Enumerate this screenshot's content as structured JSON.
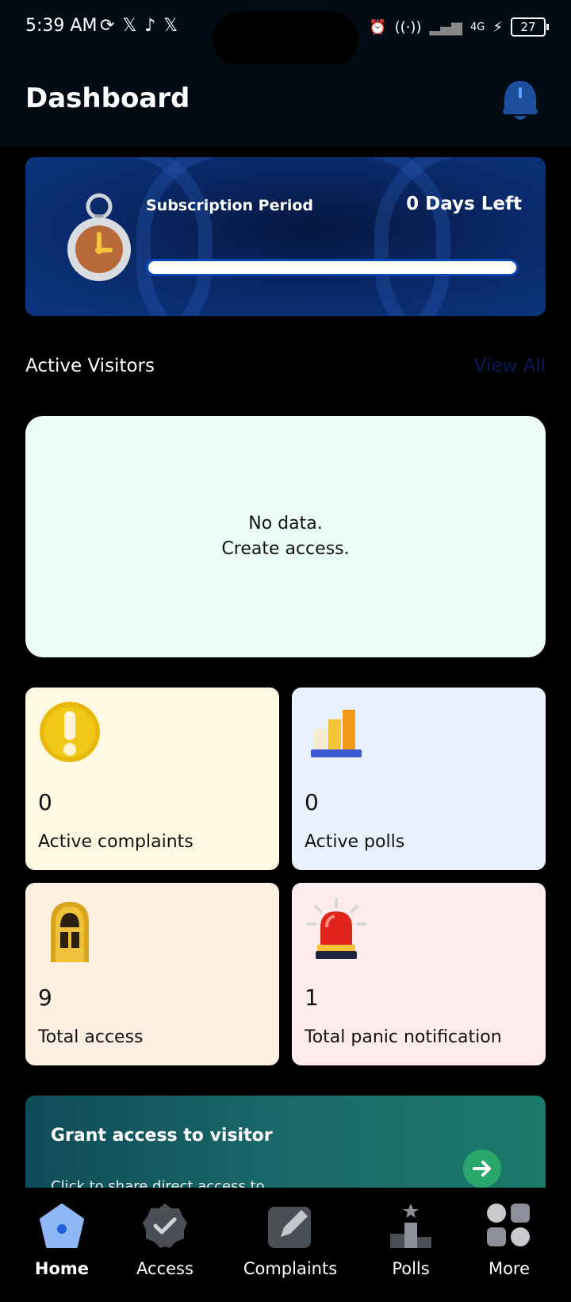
{
  "status_bar": {
    "time": "5:39 AM",
    "battery": "27",
    "network": "4G"
  },
  "header": {
    "title": "Dashboard"
  },
  "subscription": {
    "label": "Subscription Period",
    "days_left": "0 Days Left",
    "progress": 1.0
  },
  "visitors": {
    "title": "Active Visitors",
    "view_all": "View All",
    "empty_line1": "No data.",
    "empty_line2": "Create access."
  },
  "stats": [
    {
      "value": "0",
      "label": "Active complaints"
    },
    {
      "value": "0",
      "label": "Active polls"
    },
    {
      "value": "9",
      "label": "Total access"
    },
    {
      "value": "1",
      "label": "Total panic notification"
    }
  ],
  "banner": {
    "title": "Grant access to visitor",
    "subtitle": "Click to share direct access to",
    "accent": "#2aa86b"
  },
  "nav": [
    {
      "label": "Home",
      "icon": "home-icon"
    },
    {
      "label": "Access",
      "icon": "access-badge-icon"
    },
    {
      "label": "Complaints",
      "icon": "edit-icon"
    },
    {
      "label": "Polls",
      "icon": "podium-icon"
    },
    {
      "label": "More",
      "icon": "grid-icon"
    }
  ]
}
